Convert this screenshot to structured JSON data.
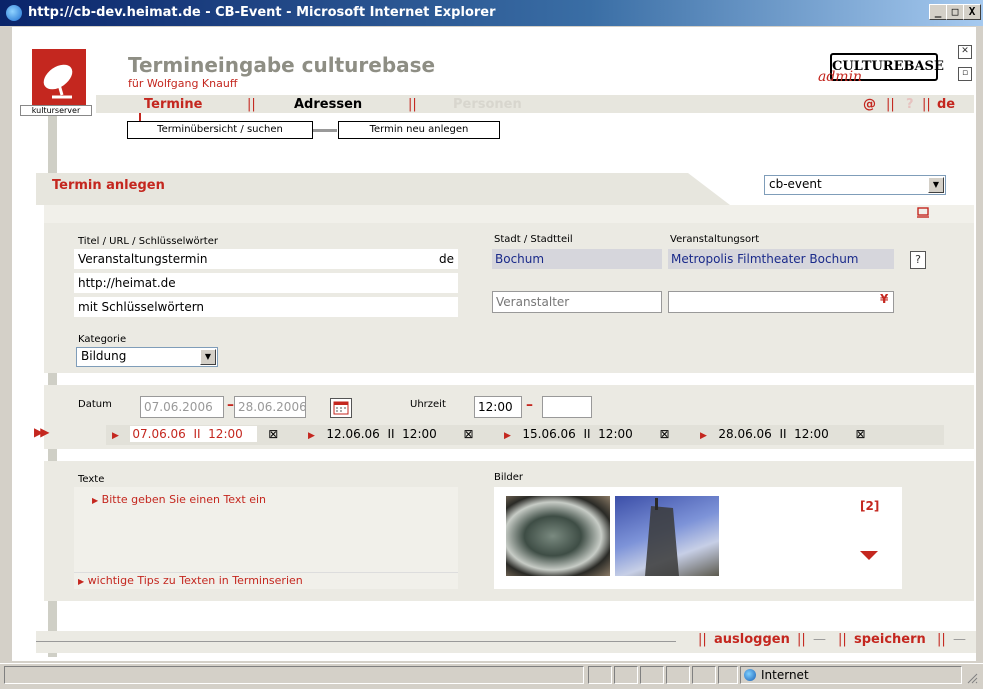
{
  "window": {
    "title": "http://cb-dev.heimat.de - CB-Event - Microsoft Internet Explorer",
    "minimize": "_",
    "maximize": "□",
    "close": "X"
  },
  "header": {
    "logo_label": "kulturserver",
    "title": "Termineingabe culturebase",
    "subtitle": "für  Wolfgang Knauff",
    "brand": "CULTUREBASE",
    "brand_sub": "admin"
  },
  "nav": {
    "termine": "Termine",
    "sep1": "||",
    "adressen": "Adressen",
    "sep2": "||",
    "personen": "Personen",
    "right": {
      "at": "@",
      "sep1": "||",
      "help": "?",
      "sep2": "||",
      "lang": "de"
    }
  },
  "subtabs": {
    "overview": "Terminübersicht / suchen",
    "new": "Termin neu anlegen"
  },
  "section": {
    "title": "Termin anlegen",
    "profile_select": "cb-event"
  },
  "form": {
    "title_label": "Titel / URL / Schlüsselwörter",
    "title_value": "Veranstaltungstermin",
    "title_lang": "de",
    "url_value": "http://heimat.de",
    "keywords_value": "mit Schlüsselwörtern",
    "city_label": "Stadt / Stadtteil",
    "city_value": "Bochum",
    "venue_label": "Veranstaltungsort",
    "venue_value": "Metropolis Filmtheater Bochum",
    "venue_help": "?",
    "organizer_placeholder": "Veranstalter",
    "organizer_arrow": "¥",
    "category_label": "Kategorie",
    "category_value": "Bildung"
  },
  "dates": {
    "date_label": "Datum",
    "date_from": "07.06.2006",
    "date_dash": "–",
    "date_to": "28.06.2006",
    "time_label": "Uhrzeit",
    "time_from": "12:00",
    "time_dash": "–",
    "time_to": "",
    "series": [
      {
        "date": "07.06.06",
        "sep": "II",
        "time": "12:00",
        "close": "⊠"
      },
      {
        "date": "12.06.06",
        "sep": "II",
        "time": "12:00",
        "close": "⊠"
      },
      {
        "date": "15.06.06",
        "sep": "II",
        "time": "12:00",
        "close": "⊠"
      },
      {
        "date": "28.06.06",
        "sep": "II",
        "time": "12:00",
        "close": "⊠"
      }
    ]
  },
  "texts": {
    "label": "Texte",
    "prompt": "Bitte geben Sie einen Text ein",
    "tips": "wichtige Tips zu Texten in Terminserien"
  },
  "images": {
    "label": "Bilder",
    "count": "[2]"
  },
  "footer": {
    "sep1": "||",
    "logout": "ausloggen",
    "sep2": "||",
    "dash1": "—",
    "sep3": "||",
    "save": "speichern",
    "sep4": "||",
    "dash2": "—"
  },
  "status": {
    "zone": "Internet"
  },
  "colors": {
    "accent": "#c4271f",
    "panel": "#ebeae3",
    "link_blue": "#1a2a8a"
  }
}
